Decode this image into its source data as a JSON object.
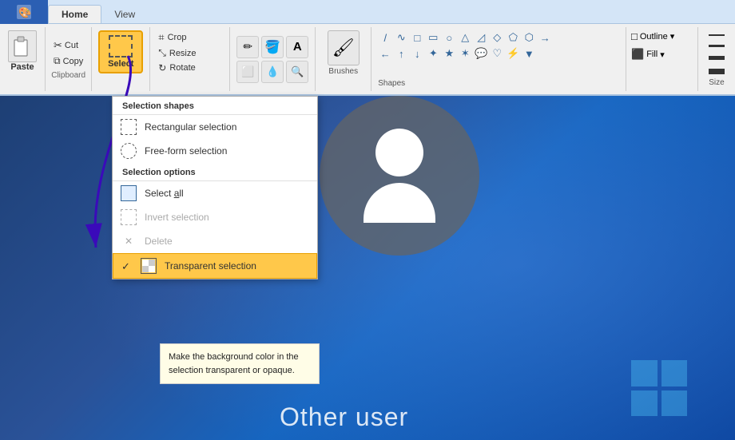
{
  "app": {
    "title": "Paint",
    "tab_home": "Home",
    "tab_view": "View"
  },
  "ribbon": {
    "clipboard_label": "Clipboard",
    "shapes_label": "Shapes",
    "paste_label": "Paste",
    "cut_label": "Cut",
    "copy_label": "Copy",
    "select_label": "Select",
    "crop_label": "Crop",
    "resize_label": "Resize",
    "rotate_label": "Rotate",
    "brushes_label": "Brushes",
    "outline_label": "Outline",
    "fill_label": "Fill",
    "size_label": "Size"
  },
  "dropdown": {
    "section1_header": "Selection shapes",
    "item_rectangular": "Rectangular selection",
    "item_freeform": "Free-form selection",
    "section2_header": "Selection options",
    "item_select_all": "Select all",
    "item_invert": "Invert selection",
    "item_delete": "Delete",
    "item_transparent": "Transparent selection",
    "transparent_checked": true
  },
  "tooltip": {
    "text": "Make the background color in the selection transparent or opaque."
  },
  "user_section": {
    "other_user_label": "Other user"
  }
}
